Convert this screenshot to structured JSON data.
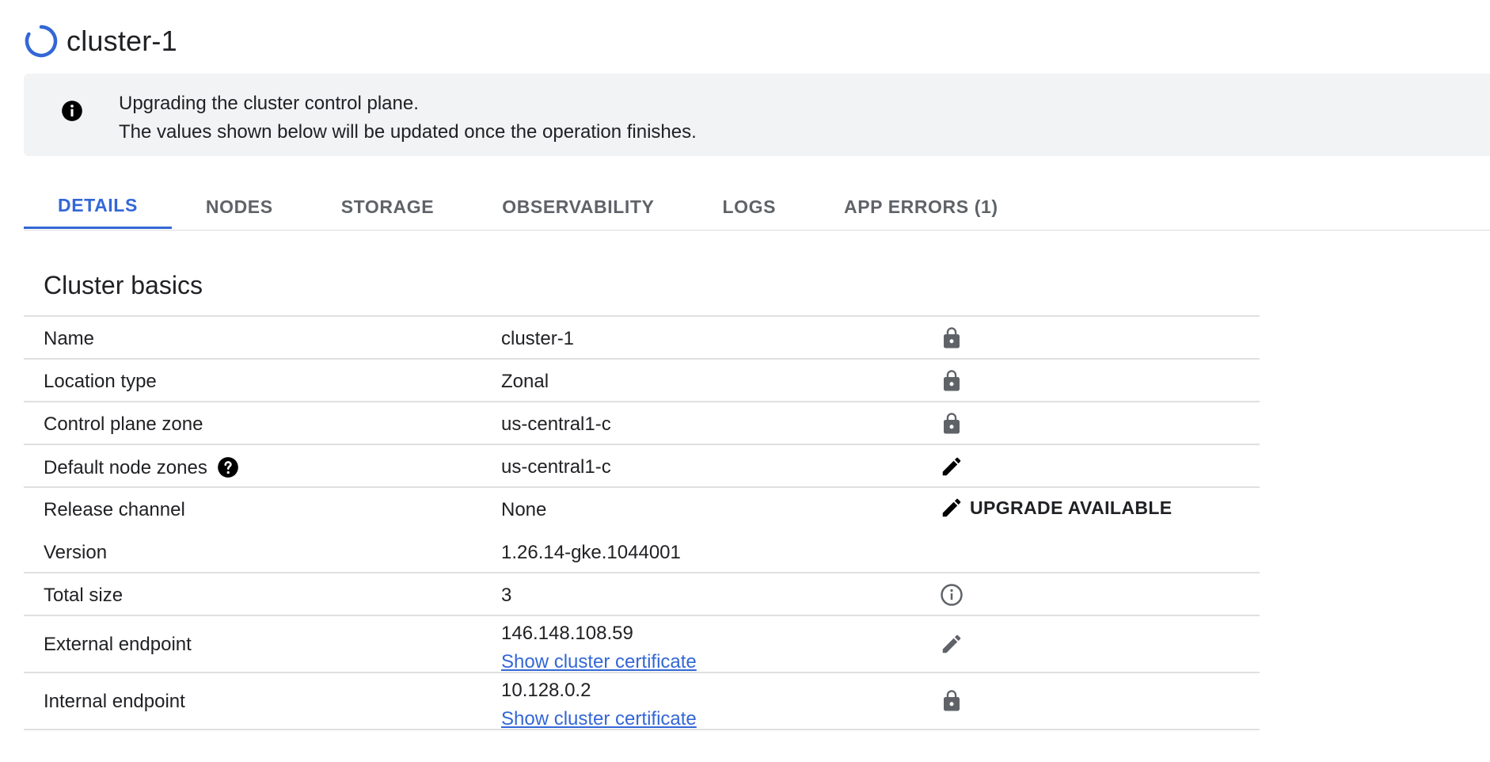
{
  "header": {
    "title": "cluster-1",
    "status_icon": "loading-spinner-icon"
  },
  "banner": {
    "icon": "info-icon",
    "line1": "Upgrading the cluster control plane.",
    "line2": "The values shown below will be updated once the operation finishes."
  },
  "tabs": [
    {
      "label": "DETAILS",
      "active": true
    },
    {
      "label": "NODES",
      "active": false
    },
    {
      "label": "STORAGE",
      "active": false
    },
    {
      "label": "OBSERVABILITY",
      "active": false
    },
    {
      "label": "LOGS",
      "active": false
    },
    {
      "label": "APP ERRORS (1)",
      "active": false
    }
  ],
  "section": {
    "title": "Cluster basics",
    "rows": {
      "name": {
        "label": "Name",
        "value": "cluster-1",
        "icon": "lock-icon"
      },
      "location_type": {
        "label": "Location type",
        "value": "Zonal",
        "icon": "lock-icon"
      },
      "control_plane_zone": {
        "label": "Control plane zone",
        "value": "us-central1-c",
        "icon": "lock-icon"
      },
      "default_node_zones": {
        "label": "Default node zones",
        "value": "us-central1-c",
        "icon": "edit-icon",
        "help_icon": "help-icon"
      },
      "release_channel": {
        "label": "Release channel",
        "value": "None",
        "icon": "edit-icon",
        "action": "UPGRADE AVAILABLE"
      },
      "version": {
        "label": "Version",
        "value": "1.26.14-gke.1044001"
      },
      "total_size": {
        "label": "Total size",
        "value": "3",
        "icon": "info-outline-icon"
      },
      "external_endpoint": {
        "label": "External endpoint",
        "value": "146.148.108.59",
        "link": "Show cluster certificate",
        "icon": "edit-icon"
      },
      "internal_endpoint": {
        "label": "Internal endpoint",
        "value": "10.128.0.2",
        "link": "Show cluster certificate",
        "icon": "lock-icon"
      }
    }
  },
  "colors": {
    "accent": "#3367d6",
    "banner_bg": "#f1f3f4",
    "icon_gray": "#5f6368",
    "divider": "#e0e0e0"
  }
}
